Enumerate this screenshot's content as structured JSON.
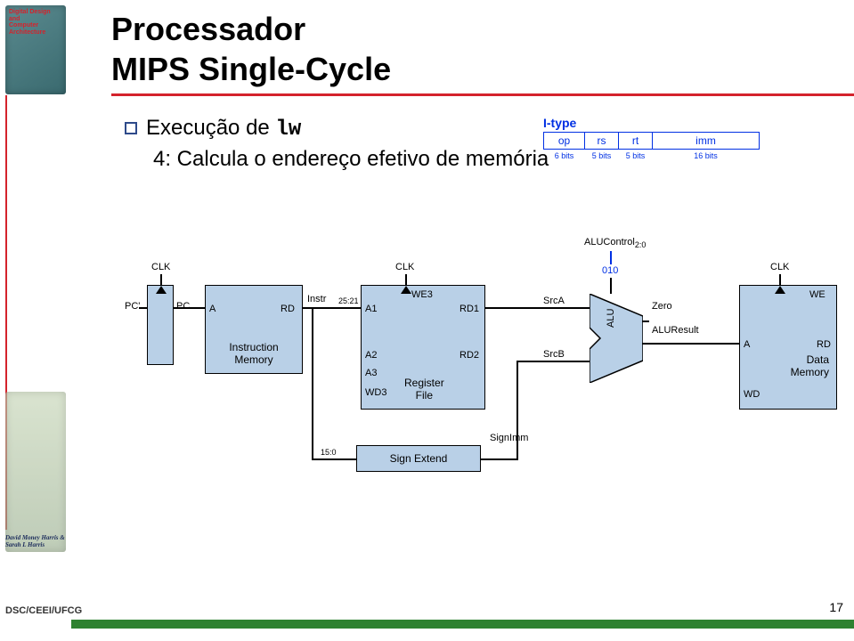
{
  "title_line1": "Processador",
  "title_line2": "MIPS Single-Cycle",
  "bullet1_pre": "Execução de ",
  "bullet1_code": "lw",
  "bullet1_sub": "4: Calcula o endereço efetivo de memória",
  "itype": {
    "label": "I-type",
    "fields": [
      "op",
      "rs",
      "rt",
      "imm"
    ],
    "bits": [
      "6 bits",
      "5 bits",
      "5 bits",
      "16 bits"
    ]
  },
  "diagram": {
    "clk": "CLK",
    "pc_next": "PC'",
    "pc": "PC",
    "A": "A",
    "RD": "RD",
    "instr_memory_l1": "Instruction",
    "instr_memory_l2": "Memory",
    "instr": "Instr",
    "bits_25_21": "25:21",
    "A1": "A1",
    "WE3": "WE3",
    "RD1": "RD1",
    "A2": "A2",
    "RD2": "RD2",
    "A3": "A3",
    "WD3": "WD3",
    "register_l1": "Register",
    "register_l2": "File",
    "srcA": "SrcA",
    "srcB": "SrcB",
    "zero": "Zero",
    "alu_result": "ALUResult",
    "alu_control": "ALUControl",
    "alu_control_sub": "2:0",
    "alu_control_val": "010",
    "alu": "ALU",
    "WE": "WE",
    "data_l1": "Data",
    "data_l2": "Memory",
    "WD": "WD",
    "bits_15_0": "15:0",
    "sign_extend": "Sign Extend",
    "sign_imm": "SignImm"
  },
  "book": {
    "title_l1": "Digital Design and",
    "title_l2": "Computer Architecture",
    "authors": "David Money Harris & Sarah L Harris"
  },
  "footer": "DSC/CEEI/UFCG",
  "page_num": "17"
}
